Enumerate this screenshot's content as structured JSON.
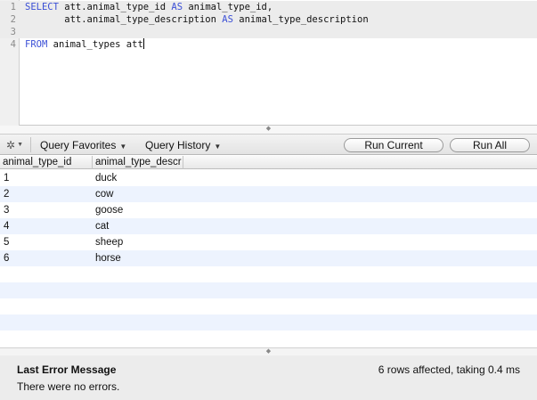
{
  "editor": {
    "lines": [
      {
        "num": "1",
        "code": [
          {
            "t": "SELECT",
            "kw": true
          },
          {
            "t": " att.animal_type_id "
          },
          {
            "t": "AS",
            "kw": true
          },
          {
            "t": " animal_type_id,"
          }
        ]
      },
      {
        "num": "2",
        "code": [
          {
            "t": "       att.animal_type_description "
          },
          {
            "t": "AS",
            "kw": true
          },
          {
            "t": " animal_type_description"
          }
        ]
      },
      {
        "num": "3",
        "code": []
      },
      {
        "num": "4",
        "code": [
          {
            "t": "FROM",
            "kw": true
          },
          {
            "t": " animal_types att"
          }
        ]
      }
    ]
  },
  "toolbar": {
    "query_favorites": "Query Favorites",
    "query_history": "Query History",
    "run_current": "Run Current",
    "run_all": "Run All"
  },
  "results": {
    "columns": [
      "animal_type_id",
      "animal_type_descr"
    ],
    "rows": [
      [
        "1",
        "duck"
      ],
      [
        "2",
        "cow"
      ],
      [
        "3",
        "goose"
      ],
      [
        "4",
        "cat"
      ],
      [
        "5",
        "sheep"
      ],
      [
        "6",
        "horse"
      ]
    ]
  },
  "status": {
    "title": "Last Error Message",
    "message": "There were no errors.",
    "summary": "6 rows affected, taking 0.4 ms"
  },
  "colors": {
    "keyword": "#3b4fd6",
    "alt_row": "#edf3fe"
  }
}
